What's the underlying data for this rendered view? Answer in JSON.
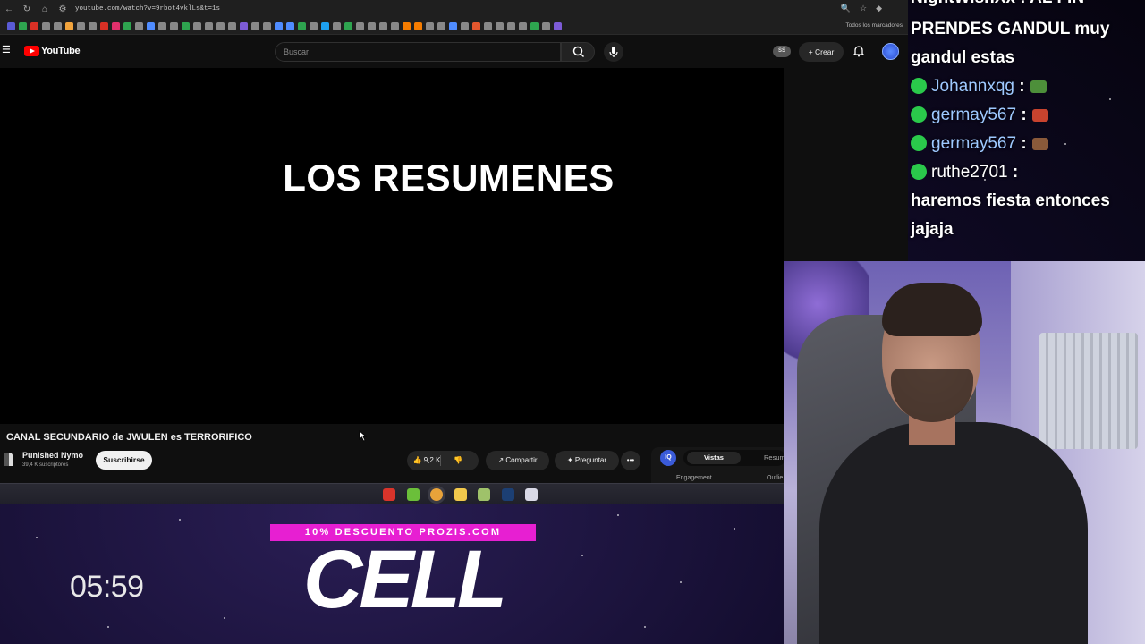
{
  "browser": {
    "url": "youtube.com/watch?v=9rbot4vklLs&t=1s",
    "bookmarks_folder": "Todos los marcadores",
    "bookmark_colors": [
      "#5a5bd6",
      "#2ea44f",
      "#d93025",
      "#888",
      "#888",
      "#f1a33c",
      "#888",
      "#888",
      "#d93025",
      "#e1306c",
      "#2ea44f",
      "#888",
      "#4f8cff",
      "#888",
      "#888",
      "#2ea44f",
      "#888",
      "#888",
      "#888",
      "#888",
      "#7d5bd6",
      "#888",
      "#888",
      "#4f8cff",
      "#4f8cff",
      "#2ea44f",
      "#888",
      "#1da1f2",
      "#888",
      "#2ea44f",
      "#888",
      "#888",
      "#888",
      "#888",
      "#f57c00",
      "#f57c00",
      "#888",
      "#888",
      "#4f8cff",
      "#888",
      "#e4572e",
      "#888",
      "#888",
      "#888",
      "#888",
      "#2ea44f",
      "#888",
      "#7d5bd6"
    ]
  },
  "youtube": {
    "logo_text": "YouTube",
    "search_placeholder": "Buscar",
    "ss_badge": "SS",
    "create_label": "+ Crear",
    "player_text": "LOS RESUMENES",
    "video_title": "CANAL SECUNDARIO de JWULEN es TERRORIFICO",
    "channel_name": "Punished Nymo",
    "channel_subs": "39,4 K suscriptores",
    "subscribe_label": "Suscribirse",
    "like_count": "9,2 K",
    "share_label": "Compartir",
    "ask_label": "Preguntar",
    "more_label": "•••",
    "ext_logo": "IQ",
    "ext_tab_active": "Vistas",
    "ext_tab_other": "Resum",
    "ext_engagement": "Engagement",
    "ext_outlier": "Outlie"
  },
  "taskbar": {
    "icons": [
      {
        "name": "record-icon",
        "color": "#d9342b"
      },
      {
        "name": "xbox-icon",
        "color": "#6bbf3a"
      },
      {
        "name": "chrome-icon",
        "color": "#e8a33a"
      },
      {
        "name": "file-explorer-icon",
        "color": "#f2c94c"
      },
      {
        "name": "app-icon",
        "color": "#9fc26a"
      },
      {
        "name": "photoshop-icon",
        "color": "#1c3f73"
      },
      {
        "name": "app-icon-2",
        "color": "#d9d9e6"
      }
    ]
  },
  "overlay": {
    "timer": "05:59",
    "promo": "10% DESCUENTO PROZIS.COM",
    "brand": "CELL"
  },
  "chat": {
    "top_cut": "NightWishXx : AL FIN",
    "messages": [
      {
        "text": "PRENDES GANDUL muy"
      },
      {
        "text": "gandul estas"
      },
      {
        "user": "Johannxqg",
        "suffix": " :",
        "user_color": "#9ec9ff",
        "emote": "#4d8f3a"
      },
      {
        "user": "germay567",
        "suffix": " :",
        "user_color": "#9ec9ff",
        "emote": "#c8432e"
      },
      {
        "user": "germay567",
        "suffix": " :",
        "user_color": "#9ec9ff",
        "emote": "#8a5a3a"
      },
      {
        "user": "ruthe2701",
        "suffix": " :",
        "user_color": "#ffffff"
      },
      {
        "text": "haremos fiesta entonces"
      },
      {
        "text": "jajaja"
      }
    ]
  },
  "colors": {
    "youtube_red": "#ff0000",
    "promo_magenta": "#e71fd2",
    "chat_badge": "#2ac94b"
  }
}
